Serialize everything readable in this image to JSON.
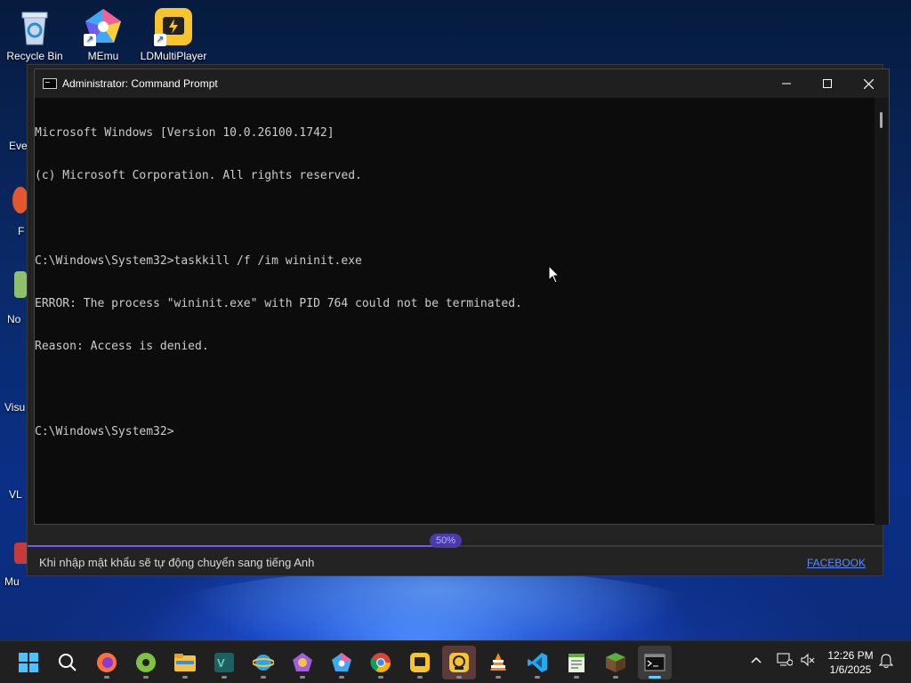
{
  "desktop": {
    "icons": [
      {
        "label": "Recycle Bin",
        "icon": "recycle-bin-icon"
      },
      {
        "label": "MEmu",
        "icon": "memu-icon"
      },
      {
        "label": "LDMultiPlayer",
        "icon": "ldmultiplayer-icon"
      }
    ],
    "left_partial_labels": [
      "Eve",
      "F",
      "No",
      "Visu",
      "VL",
      "Mu"
    ]
  },
  "launcher": {
    "progress_percent": 50,
    "progress_label": "50%",
    "note": "Khi nhập mật khẩu sẽ tự động chuyển sang tiếng Anh",
    "link": "FACEBOOK"
  },
  "cmd": {
    "title": "Administrator: Command Prompt",
    "lines": [
      "Microsoft Windows [Version 10.0.26100.1742]",
      "(c) Microsoft Corporation. All rights reserved.",
      "",
      "C:\\Windows\\System32>taskkill /f /im wininit.exe",
      "ERROR: The process \"wininit.exe\" with PID 764 could not be terminated.",
      "Reason: Access is denied.",
      "",
      "C:\\Windows\\System32>"
    ]
  },
  "taskbar": {
    "apps": [
      "start-icon",
      "search-icon",
      "firefox-icon",
      "green-disc-icon",
      "file-explorer-icon",
      "vb-icon",
      "ie-icon",
      "chromium-icon",
      "gem-icon",
      "chrome-icon",
      "ldplayer-icon",
      "lockdown-icon",
      "vlc-icon",
      "vscode-icon",
      "notepad-icon",
      "minecraft-icon",
      "terminal-icon"
    ],
    "time": "12:26 PM",
    "date": "1/6/2025"
  },
  "colors": {
    "accent": "#60cdff",
    "progress": "#7755ff",
    "link": "#5b8bff",
    "console_text": "#cccccc"
  }
}
